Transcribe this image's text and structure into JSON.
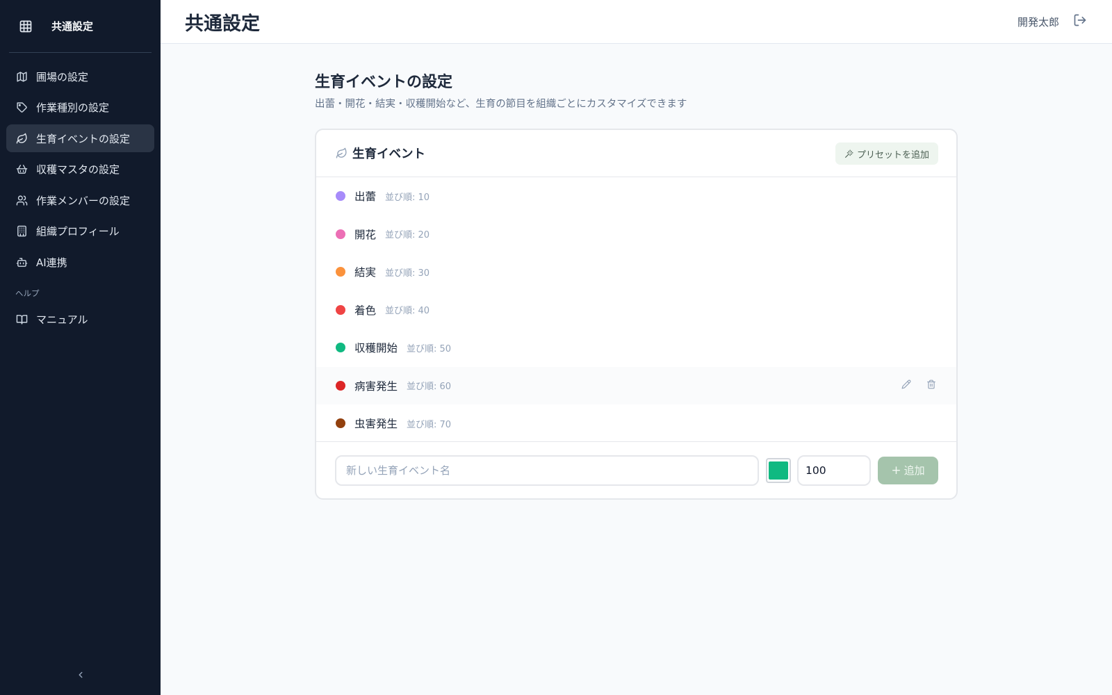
{
  "sidebar": {
    "title": "共通設定",
    "items": [
      {
        "label": "圃場の設定",
        "icon": "map-icon"
      },
      {
        "label": "作業種別の設定",
        "icon": "tag-icon"
      },
      {
        "label": "生育イベントの設定",
        "icon": "leaf-icon",
        "active": true
      },
      {
        "label": "収穫マスタの設定",
        "icon": "basket-icon"
      },
      {
        "label": "作業メンバーの設定",
        "icon": "users-icon"
      },
      {
        "label": "組織プロフィール",
        "icon": "building-icon"
      },
      {
        "label": "AI連携",
        "icon": "bot-icon"
      }
    ],
    "help_section": "ヘルプ",
    "help_items": [
      {
        "label": "マニュアル",
        "icon": "book-icon"
      }
    ]
  },
  "topbar": {
    "title": "共通設定",
    "user": "開発太郎"
  },
  "main": {
    "heading": "生育イベントの設定",
    "description": "出蕾・開花・結実・収穫開始など、生育の節目を組織ごとにカスタマイズできます"
  },
  "card": {
    "title": "生育イベント",
    "preset_label": "プリセットを追加",
    "events": [
      {
        "name": "出蕾",
        "order": "並び順: 10",
        "color": "#a78bfa"
      },
      {
        "name": "開花",
        "order": "並び順: 20",
        "color": "#ec6fb5"
      },
      {
        "name": "結実",
        "order": "並び順: 30",
        "color": "#fb923c"
      },
      {
        "name": "着色",
        "order": "並び順: 40",
        "color": "#ef4444"
      },
      {
        "name": "収穫開始",
        "order": "並び順: 50",
        "color": "#10b981"
      },
      {
        "name": "病害発生",
        "order": "並び順: 60",
        "color": "#dc2626"
      },
      {
        "name": "虫害発生",
        "order": "並び順: 70",
        "color": "#92400e"
      }
    ],
    "new_event": {
      "placeholder": "新しい生育イベント名",
      "color": "#10b981",
      "order_value": "100",
      "add_label": "追加"
    }
  },
  "colors": {
    "sidebar_bg": "#111a2b",
    "accent_green": "#a5c4ac"
  }
}
